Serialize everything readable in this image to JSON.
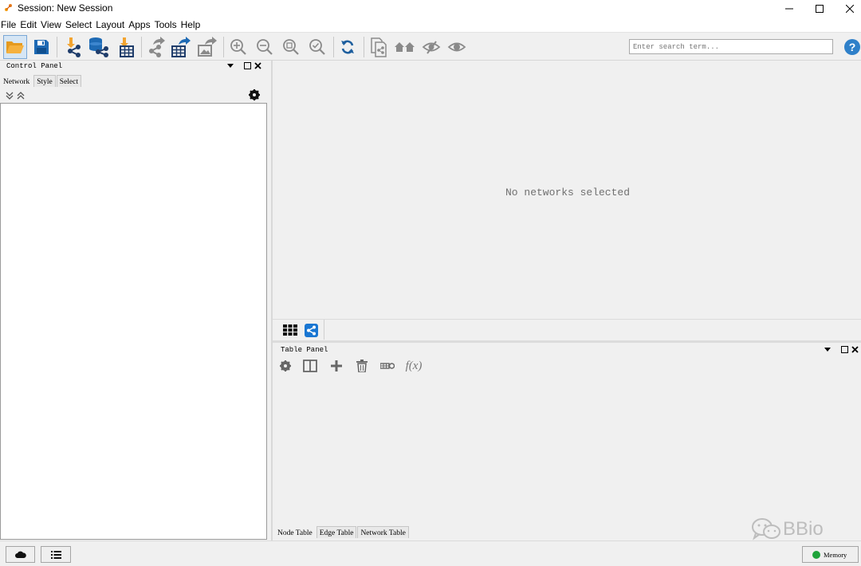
{
  "window": {
    "title": "Session: New Session",
    "controls": [
      "minimize-icon",
      "maximize-icon",
      "close-icon"
    ]
  },
  "menu": [
    "File",
    "Edit",
    "View",
    "Select",
    "Layout",
    "Apps",
    "Tools",
    "Help"
  ],
  "toolbar": {
    "buttons": [
      "open-session-icon",
      "save-session-icon",
      "import-network-file-icon",
      "import-network-database-icon",
      "import-table-icon",
      "export-network-icon",
      "export-table-icon",
      "export-image-icon",
      "zoom-in-icon",
      "zoom-out-icon",
      "zoom-fit-icon",
      "zoom-selected-icon",
      "refresh-icon",
      "new-network-from-selection-icon",
      "home-icon",
      "hide-selected-icon",
      "show-all-icon"
    ],
    "search_placeholder": "Enter search term..."
  },
  "control_panel": {
    "title": "Control Panel",
    "tabs": [
      "Network",
      "Style",
      "Select"
    ]
  },
  "network_view": {
    "empty_message": "No networks selected"
  },
  "table_panel": {
    "title": "Table Panel",
    "function_label": "f(x)",
    "tabs": [
      "Node Table",
      "Edge Table",
      "Network Table"
    ]
  },
  "statusbar": {
    "memory_label": "Memory"
  },
  "watermark": {
    "text": "BBio"
  },
  "colors": {
    "accent_blue": "#1976d2",
    "folder_orange": "#f3a430",
    "memory_green": "#1fa33a"
  }
}
